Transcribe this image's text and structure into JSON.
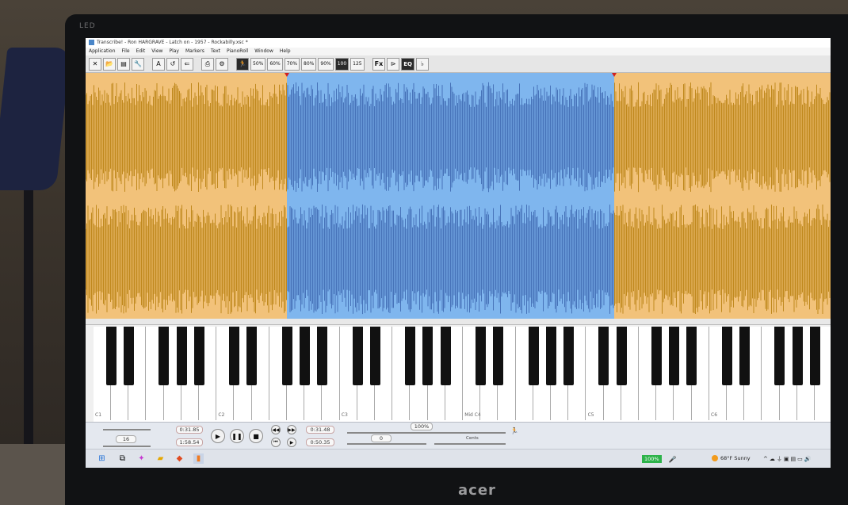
{
  "monitor": {
    "brand_top": "LED",
    "brand": "acer"
  },
  "window": {
    "title": "Transcribe! - Ron HARGRAVE - Latch on - 1957 - Rockabilly.xsc *"
  },
  "menu": [
    "Application",
    "File",
    "Edit",
    "View",
    "Play",
    "Markers",
    "Text",
    "PianoRoll",
    "Window",
    "Help"
  ],
  "toolbar": {
    "icons": [
      "close-icon",
      "open-icon",
      "save-icon",
      "wrench-icon",
      "ab-icon",
      "loop-icon",
      "back-icon",
      "print-icon",
      "settings-icon",
      "runner-icon"
    ],
    "speeds": [
      "50%",
      "60%",
      "70%",
      "80%",
      "90%",
      "100",
      "125"
    ],
    "selected_speed": "100",
    "fx": "Fx",
    "eq": "EQ"
  },
  "waveform": {
    "selection_start_fraction": 0.27,
    "selection_end_fraction": 0.71,
    "colors": {
      "bg": "#f2c27a",
      "wave": "#b8800f",
      "sel_bg": "#7fb6ee",
      "sel_wave": "#1a3d8f"
    }
  },
  "piano": {
    "labels": [
      "C1",
      "C2",
      "C3",
      "Mid C4",
      "C5",
      "C6"
    ]
  },
  "transport": {
    "position": "0:31.85",
    "length": "1:58.54",
    "volume": "16",
    "loop_start": "0:31.48",
    "loop_end": "0:50.35",
    "speed": "100%",
    "pitch": "0",
    "cents_label": "Cents"
  },
  "taskbar": {
    "zoom": "100%",
    "weather": "68°F  Sunny"
  }
}
